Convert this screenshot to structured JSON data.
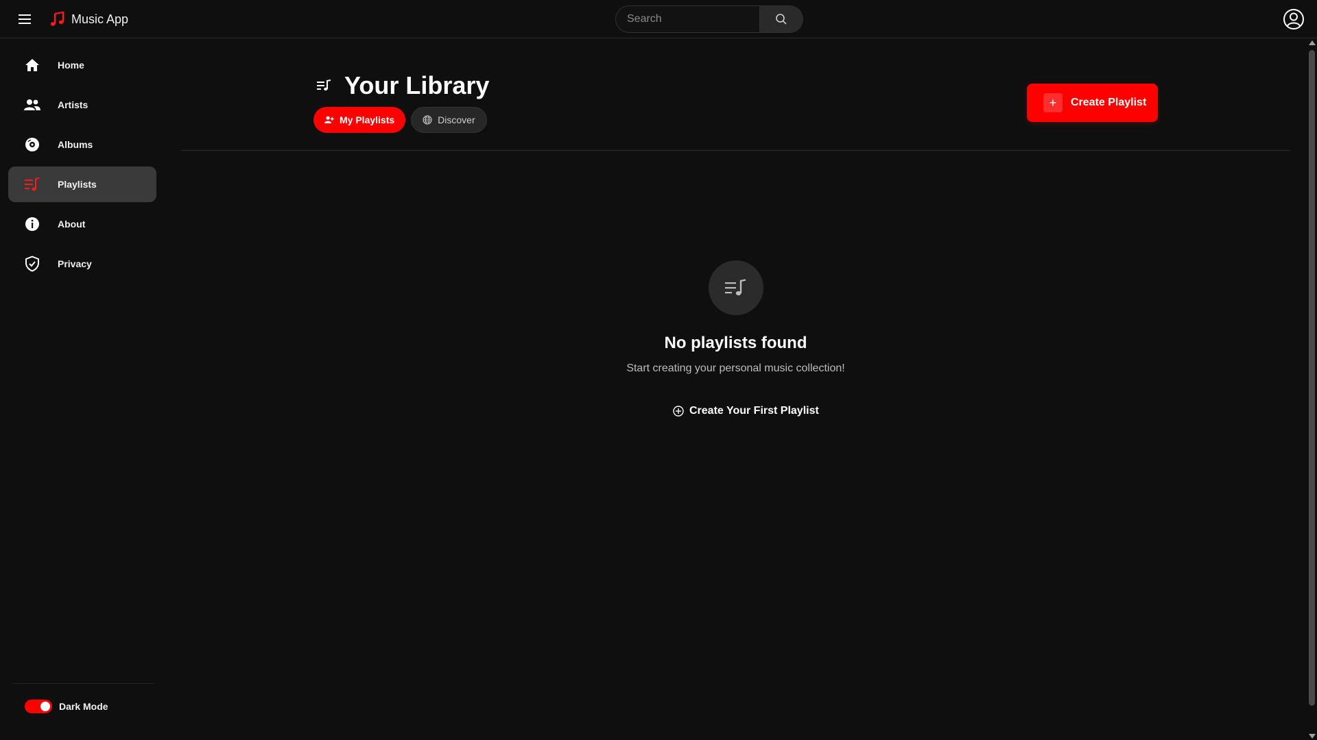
{
  "app": {
    "name": "Music App"
  },
  "search": {
    "placeholder": "Search"
  },
  "sidebar": {
    "items": [
      {
        "label": "Home",
        "icon": "home-icon"
      },
      {
        "label": "Artists",
        "icon": "people-icon"
      },
      {
        "label": "Albums",
        "icon": "disc-icon"
      },
      {
        "label": "Playlists",
        "icon": "playlist-icon",
        "active": true
      },
      {
        "label": "About",
        "icon": "info-icon"
      },
      {
        "label": "Privacy",
        "icon": "shield-icon"
      }
    ],
    "dark_mode_label": "Dark Mode",
    "dark_mode_on": true
  },
  "library": {
    "title": "Your Library",
    "tabs": [
      {
        "label": "My Playlists",
        "icon": "user-plus-icon",
        "active": true
      },
      {
        "label": "Discover",
        "icon": "globe-icon",
        "active": false
      }
    ],
    "create_button_label": "Create Playlist",
    "create_button_icon": "+"
  },
  "empty_state": {
    "title": "No playlists found",
    "subtitle": "Start creating your personal music collection!",
    "cta_label": "Create Your First Playlist"
  },
  "colors": {
    "accent": "#ff0000",
    "background": "#0f0f0f",
    "active_item": "#3a3a3a"
  }
}
